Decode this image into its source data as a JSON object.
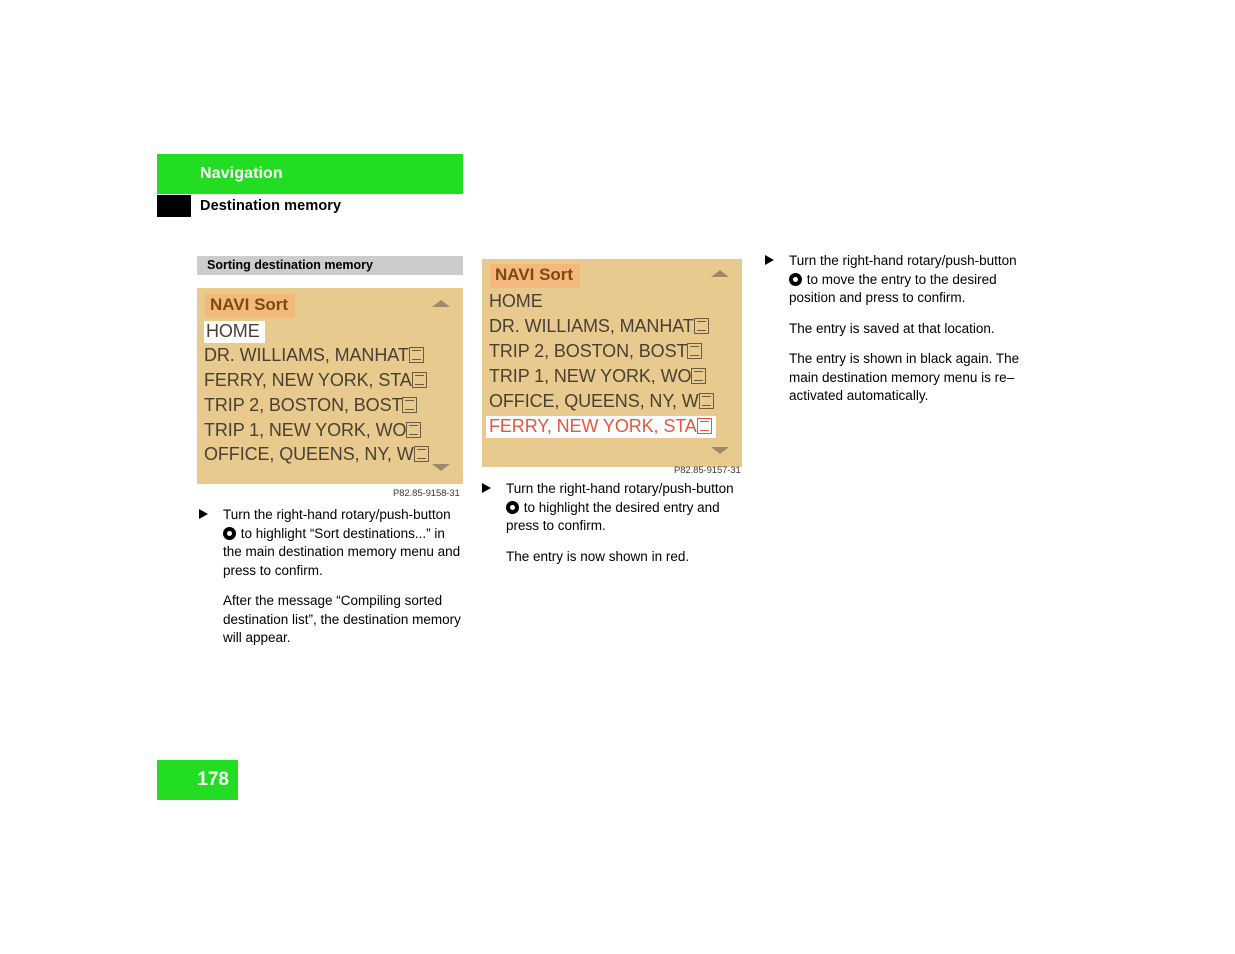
{
  "header": {
    "chapter": "Navigation",
    "section": "Destination memory"
  },
  "subsection": {
    "title": "Sorting destination memory"
  },
  "figures": [
    {
      "id": "fig-a",
      "caption": "P82.85-9158-31",
      "screen_title": "NAVI Sort",
      "scroll_up_icon": "chevron-up-icon",
      "scroll_down_icon": "chevron-down-icon",
      "rows": [
        {
          "text": "HOME",
          "state": "highlight-white",
          "truncated": false
        },
        {
          "text": "DR. WILLIAMS, MANHAT",
          "state": "normal",
          "truncated": true
        },
        {
          "text": "FERRY, NEW YORK, STA",
          "state": "normal",
          "truncated": true
        },
        {
          "text": "TRIP 2, BOSTON, BOST",
          "state": "normal",
          "truncated": true
        },
        {
          "text": "TRIP 1, NEW YORK, WO",
          "state": "normal",
          "truncated": true
        },
        {
          "text": "OFFICE, QUEENS, NY, W",
          "state": "normal",
          "truncated": true
        }
      ]
    },
    {
      "id": "fig-b",
      "caption": "P82.85-9157-31",
      "screen_title": "NAVI Sort",
      "scroll_up_icon": "chevron-up-icon",
      "scroll_down_icon": "chevron-down-icon",
      "rows": [
        {
          "text": "HOME",
          "state": "normal",
          "truncated": false
        },
        {
          "text": "DR. WILLIAMS, MANHAT",
          "state": "normal",
          "truncated": true
        },
        {
          "text": "TRIP 2, BOSTON, BOST",
          "state": "normal",
          "truncated": true
        },
        {
          "text": "TRIP 1, NEW YORK, WO",
          "state": "normal",
          "truncated": true
        },
        {
          "text": "OFFICE, QUEENS, NY, W",
          "state": "normal",
          "truncated": true
        },
        {
          "text": "FERRY, NEW YORK, STA",
          "state": "highlight-red",
          "truncated": true
        }
      ]
    }
  ],
  "column_left": {
    "step1_line1": "Turn the right-hand rotary/push-button",
    "step1_line2": "to highlight “Sort destinations...” in the main destination memory menu and press to confirm.",
    "para1": "After the message “Compiling sorted destination list”, the destination memory will appear."
  },
  "column_middle": {
    "step1_line1": "Turn the right-hand rotary/push-button",
    "step1_line2": "to highlight the desired entry and press to confirm.",
    "para1": "The entry is now shown in red."
  },
  "column_right": {
    "step1_line1": "Turn the right-hand rotary/push-button",
    "step1_line2": "to move the entry to the desired position and press to confirm.",
    "para1": "The entry is saved at that location.",
    "para2": "The entry is shown in black again. The main destination memory menu is re–activated automatically."
  },
  "footer": {
    "page_number": "178"
  },
  "colors": {
    "chapter_green": "#22dd22",
    "screen_background": "#e8ca8e",
    "screen_title_highlight": "#f4b87a",
    "screen_title_text": "#7a4a12",
    "screen_row_text": "#4a4032",
    "highlight_red": "#e8553d",
    "subsection_grey": "#cccccc"
  }
}
